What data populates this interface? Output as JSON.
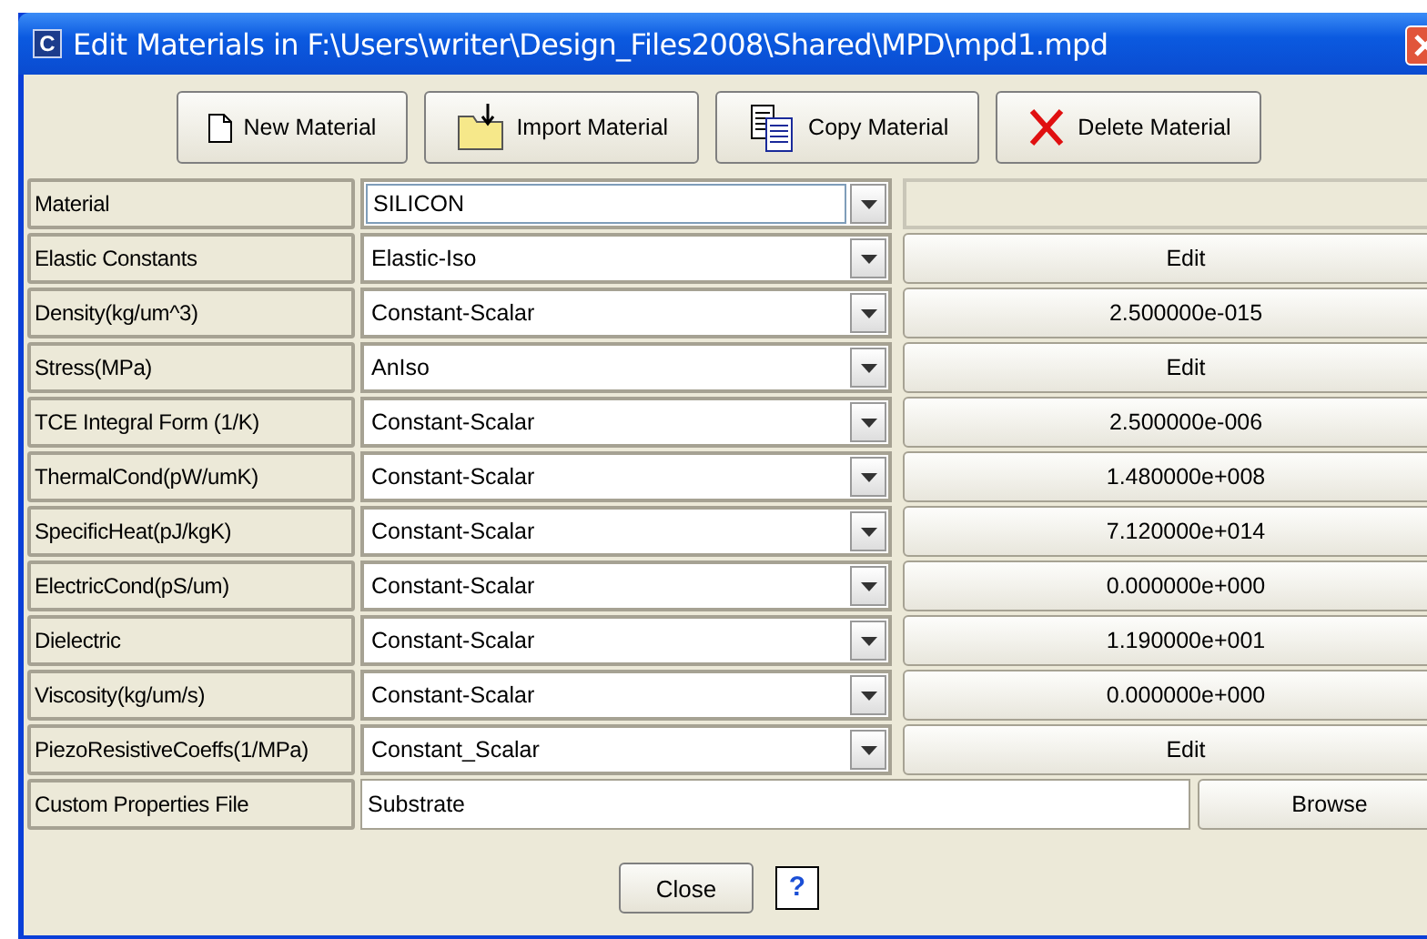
{
  "window": {
    "title": "Edit Materials in F:\\Users\\writer\\Design_Files2008\\Shared\\MPD\\mpd1.mpd",
    "app_icon": "C"
  },
  "toolbar": [
    {
      "label": "New Material",
      "kind": "new"
    },
    {
      "label": "Import Material",
      "kind": "import"
    },
    {
      "label": "Copy Material",
      "kind": "copy"
    },
    {
      "label": "Delete Material",
      "kind": "delete"
    }
  ],
  "rows": [
    {
      "kind": "editable",
      "label": "Material",
      "value": "SILICON"
    },
    {
      "kind": "property",
      "label": "Elastic Constants",
      "value": "Elastic-Iso",
      "action": "Edit"
    },
    {
      "kind": "property",
      "label": "Density(kg/um^3)",
      "value": "Constant-Scalar",
      "action": "2.500000e-015"
    },
    {
      "kind": "property",
      "label": "Stress(MPa)",
      "value": "AnIso",
      "action": "Edit"
    },
    {
      "kind": "property",
      "label": "TCE Integral Form (1/K)",
      "value": "Constant-Scalar",
      "action": "2.500000e-006"
    },
    {
      "kind": "property",
      "label": "ThermalCond(pW/umK)",
      "value": "Constant-Scalar",
      "action": "1.480000e+008"
    },
    {
      "kind": "property",
      "label": "SpecificHeat(pJ/kgK)",
      "value": "Constant-Scalar",
      "action": "7.120000e+014"
    },
    {
      "kind": "property",
      "label": "ElectricCond(pS/um)",
      "value": "Constant-Scalar",
      "action": "0.000000e+000"
    },
    {
      "kind": "property",
      "label": "Dielectric",
      "value": "Constant-Scalar",
      "action": "1.190000e+001"
    },
    {
      "kind": "property",
      "label": "Viscosity(kg/um/s)",
      "value": "Constant-Scalar",
      "action": "0.000000e+000"
    },
    {
      "kind": "property",
      "label": "PiezoResistiveCoeffs(1/MPa)",
      "value": "Constant_Scalar",
      "action": "Edit"
    },
    {
      "kind": "file",
      "label": "Custom Properties File",
      "value": "Substrate",
      "action": "Browse"
    }
  ],
  "footer": {
    "close": "Close",
    "help": "?"
  }
}
